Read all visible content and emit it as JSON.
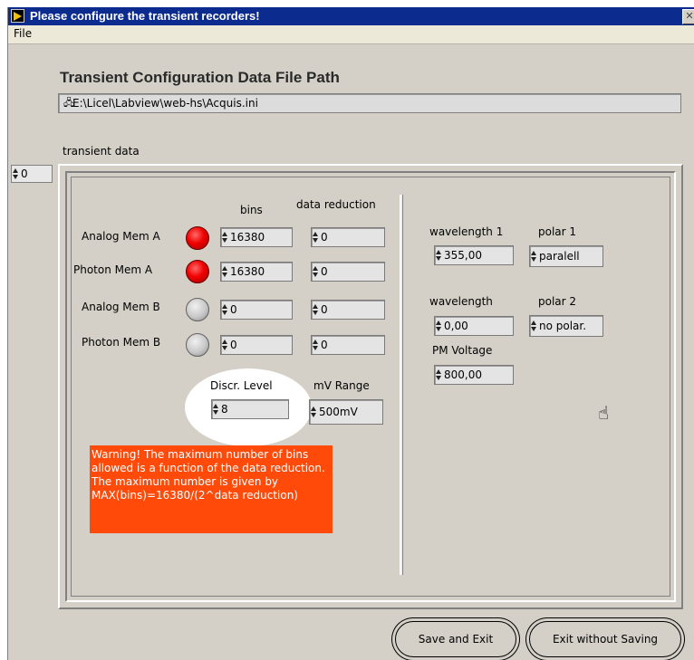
{
  "window": {
    "title": "Please configure the transient recorders!",
    "close_glyph": "✕"
  },
  "menu": {
    "file": "File"
  },
  "panel": {
    "title": "Transient Configuration Data File Path",
    "path": "E:\\Licel\\Labview\\web-hs\\Acquis.ini",
    "path_icon": "🖧",
    "transient_label": "transient data",
    "index_value": "0"
  },
  "table": {
    "bins_header": "bins",
    "reduction_header": "data reduction",
    "rows": [
      {
        "label": "Analog Mem A",
        "led": "on",
        "bins": "16380",
        "reduction": "0"
      },
      {
        "label": "Photon Mem A",
        "led": "on",
        "bins": "16380",
        "reduction": "0"
      },
      {
        "label": "Analog Mem B",
        "led": "off",
        "bins": "0",
        "reduction": "0"
      },
      {
        "label": "Photon Mem B",
        "led": "off",
        "bins": "0",
        "reduction": "0"
      }
    ],
    "discr_label": "Discr. Level",
    "discr_value": "8",
    "mv_label": "mV Range",
    "mv_value": "500mV"
  },
  "warning": "Warning! The maximum number of bins allowed is a function of the data reduction.  The maximum number is given by MAX(bins)=16380/(2^data reduction)",
  "right": {
    "wavelength1_label": "wavelength 1",
    "wavelength1_value": "355,00",
    "polar1_label": "polar 1",
    "polar1_value": "paralell",
    "wavelength2_label": "wavelength",
    "wavelength2_value": "0,00",
    "polar2_label": "polar 2",
    "polar2_value": "no polar.",
    "pm_label": "PM Voltage",
    "pm_value": "800,00"
  },
  "buttons": {
    "save": "Save and Exit",
    "exit": "Exit without Saving"
  },
  "cursor_glyph": "☝"
}
